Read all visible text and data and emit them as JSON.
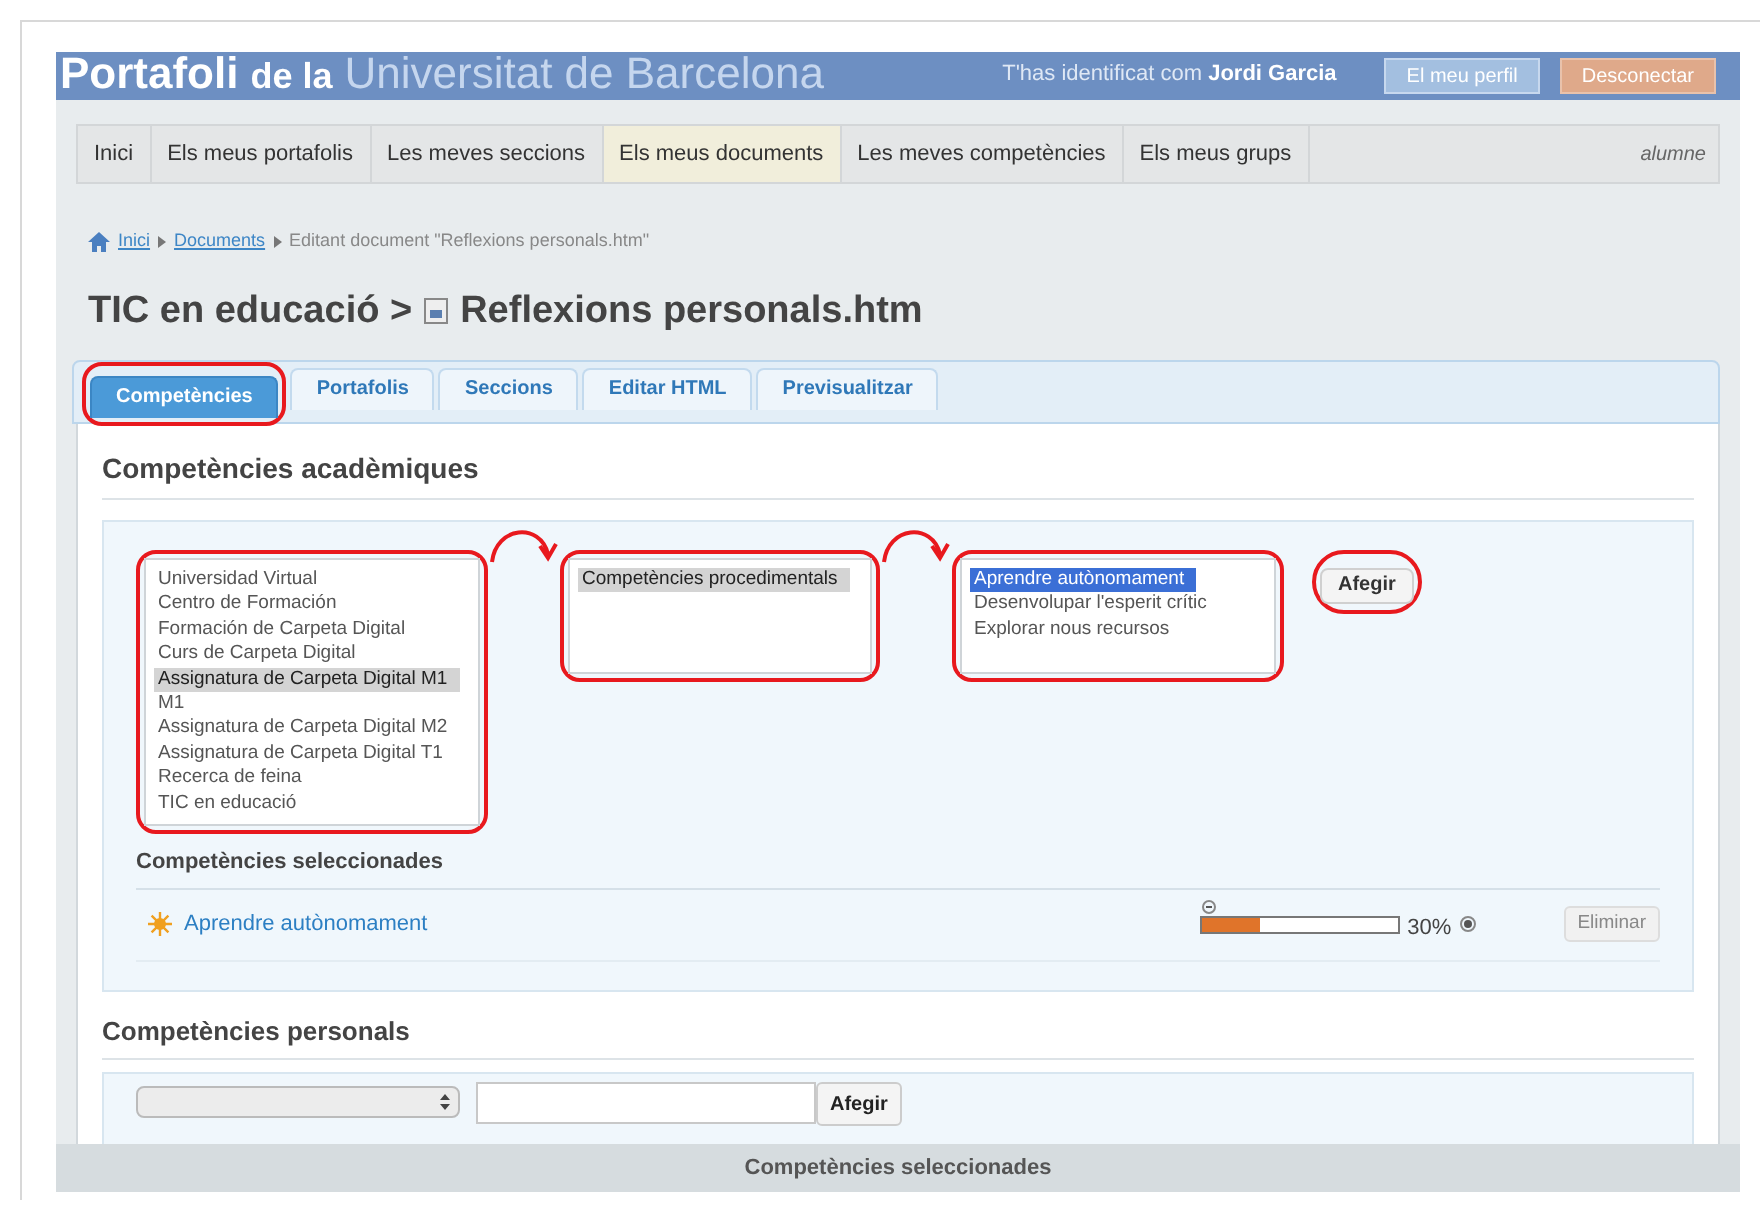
{
  "header": {
    "title_first": "Portafoli",
    "title_middle": "de la",
    "title_last": "Universitat de Barcelona",
    "user_prefix": "T'has identificat com",
    "user_name": "Jordi Garcia",
    "buttons": [
      {
        "label": "El meu perfil",
        "kind": "profile"
      },
      {
        "label": "Desconectar",
        "kind": "logout"
      }
    ]
  },
  "nav": {
    "items": [
      {
        "label": "Inici",
        "selected": false
      },
      {
        "label": "Els meus portafolis",
        "selected": false
      },
      {
        "label": "Les meves seccions",
        "selected": false
      },
      {
        "label": "Els meus documents",
        "selected": true
      },
      {
        "label": "Les meves competències",
        "selected": false
      },
      {
        "label": "Els meus grups",
        "selected": false
      }
    ],
    "role": "alumne"
  },
  "breadcrumb": {
    "links": [
      "Inici",
      "Documents"
    ],
    "current": "Editant document \"Reflexions personals.htm\""
  },
  "title": {
    "context": "TIC en educació >",
    "document": "Reflexions personals.htm"
  },
  "tabs": [
    {
      "label": "Competències",
      "selected": true,
      "annotated": true
    },
    {
      "label": "Portafolis",
      "selected": false,
      "annotated": false
    },
    {
      "label": "Seccions",
      "selected": false,
      "annotated": false
    },
    {
      "label": "Editar HTML",
      "selected": false,
      "annotated": false
    },
    {
      "label": "Previsualitzar",
      "selected": false,
      "annotated": false
    }
  ],
  "academic": {
    "heading": "Competències acadèmiques",
    "lists": [
      {
        "annotated": true,
        "items": [
          {
            "label": "Universidad Virtual",
            "selected": false
          },
          {
            "label": "Centro de Formación",
            "selected": false
          },
          {
            "label": "Formación de Carpeta Digital",
            "selected": false
          },
          {
            "label": "Curs de Carpeta Digital",
            "selected": false
          },
          {
            "label": "Assignatura de Carpeta Digital M1",
            "selected": true
          },
          {
            "label": "M1",
            "selected": false
          },
          {
            "label": "Assignatura de Carpeta Digital M2",
            "selected": false
          },
          {
            "label": "Assignatura de Carpeta Digital T1",
            "selected": false
          },
          {
            "label": "Recerca de feina",
            "selected": false
          },
          {
            "label": "TIC en educació",
            "selected": false
          }
        ]
      },
      {
        "annotated": true,
        "items": [
          {
            "label": "Competències procedimentals",
            "selected": true
          }
        ]
      },
      {
        "annotated": true,
        "items": [
          {
            "label": "Aprendre autònomament",
            "selected": true
          },
          {
            "label": "Desenvolupar l'esperit crític",
            "selected": false
          },
          {
            "label": "Explorar nous recursos",
            "selected": false
          }
        ]
      }
    ],
    "add_button": {
      "label": "Afegir",
      "annotated": true
    },
    "selected_heading": "Competències seleccionades",
    "selected": [
      {
        "name": "Aprendre autònomament",
        "level": 0.3,
        "reading": "30%",
        "remove": "Eliminar"
      }
    ]
  },
  "personal": {
    "heading": "Competències personals",
    "add_button": "Afegir",
    "footer": "Competències seleccionades"
  }
}
